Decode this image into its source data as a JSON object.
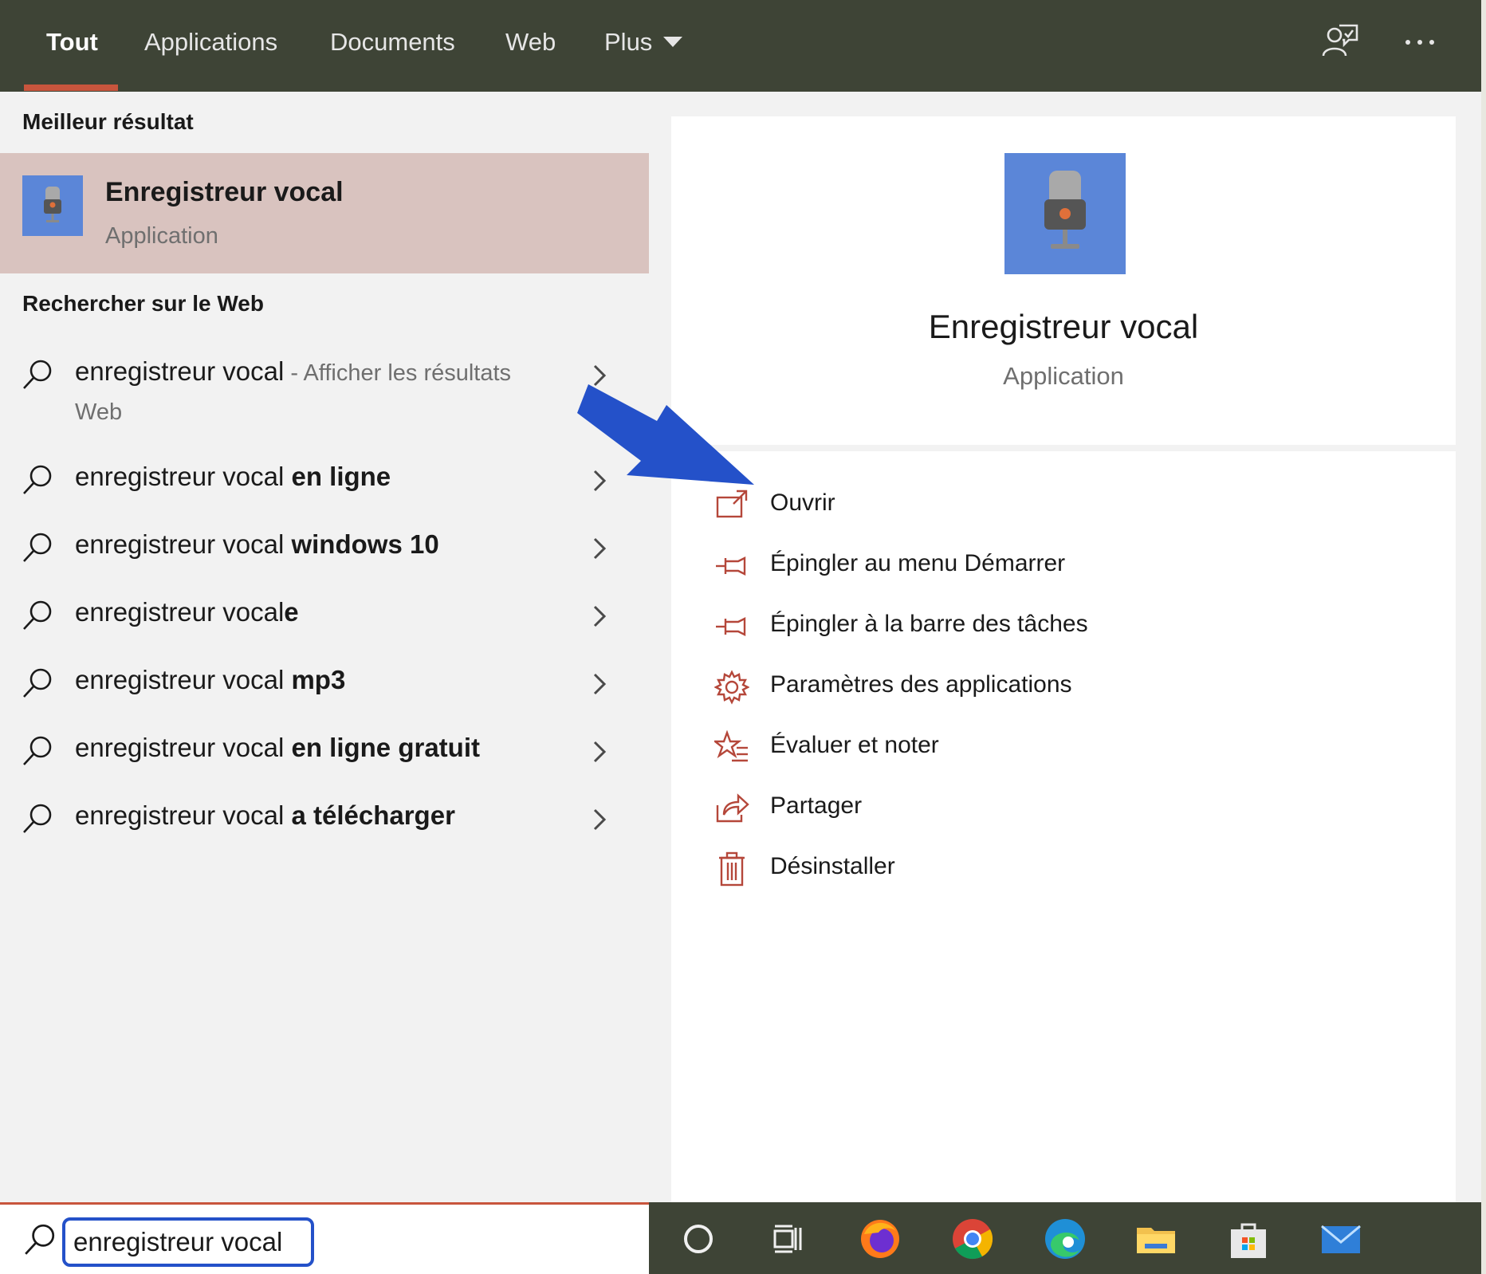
{
  "nav": {
    "tabs": [
      {
        "label": "Tout",
        "active": true
      },
      {
        "label": "Applications"
      },
      {
        "label": "Documents"
      },
      {
        "label": "Web"
      },
      {
        "label": "Plus"
      }
    ],
    "icons": [
      "feedback-icon",
      "more-options-icon"
    ]
  },
  "left": {
    "best_match_title": "Meilleur résultat",
    "best_match": {
      "name": "Enregistreur vocal",
      "type": "Application"
    },
    "web_title": "Rechercher sur le Web",
    "suggestions": [
      {
        "prefix": "enregistreur vocal",
        "bold": "",
        "hint": " - Afficher les résultats",
        "hint2": "Web"
      },
      {
        "prefix": "enregistreur vocal ",
        "bold": "en ligne"
      },
      {
        "prefix": "enregistreur vocal ",
        "bold": "windows 10"
      },
      {
        "prefix": "enregistreur vocal",
        "bold": "e"
      },
      {
        "prefix": "enregistreur vocal ",
        "bold": "mp3"
      },
      {
        "prefix": "enregistreur vocal ",
        "bold": "en ligne gratuit"
      },
      {
        "prefix": "enregistreur vocal ",
        "bold": "a télécharger"
      }
    ]
  },
  "right": {
    "app_name": "Enregistreur vocal",
    "app_type": "Application",
    "actions": [
      {
        "label": "Ouvrir",
        "icon": "open-icon"
      },
      {
        "label": "Épingler au menu Démarrer",
        "icon": "pin-icon"
      },
      {
        "label": "Épingler à la barre des tâches",
        "icon": "pin-icon"
      },
      {
        "label": "Paramètres des applications",
        "icon": "gear-icon"
      },
      {
        "label": "Évaluer et noter",
        "icon": "rate-star-icon"
      },
      {
        "label": "Partager",
        "icon": "share-icon"
      },
      {
        "label": "Désinstaller",
        "icon": "trash-icon"
      }
    ]
  },
  "search": {
    "value": "enregistreur vocal"
  },
  "taskbar": {
    "icons": [
      "cortana-icon",
      "task-view-icon",
      "firefox-icon",
      "chrome-icon",
      "edge-icon",
      "file-explorer-icon",
      "store-icon",
      "mail-icon"
    ]
  },
  "colors": {
    "accent": "#c8553d",
    "topbar": "#3e4436",
    "selected": "#d9c3bf",
    "app_tile": "#5b86d8",
    "annotation_arrow": "#2451c9"
  }
}
